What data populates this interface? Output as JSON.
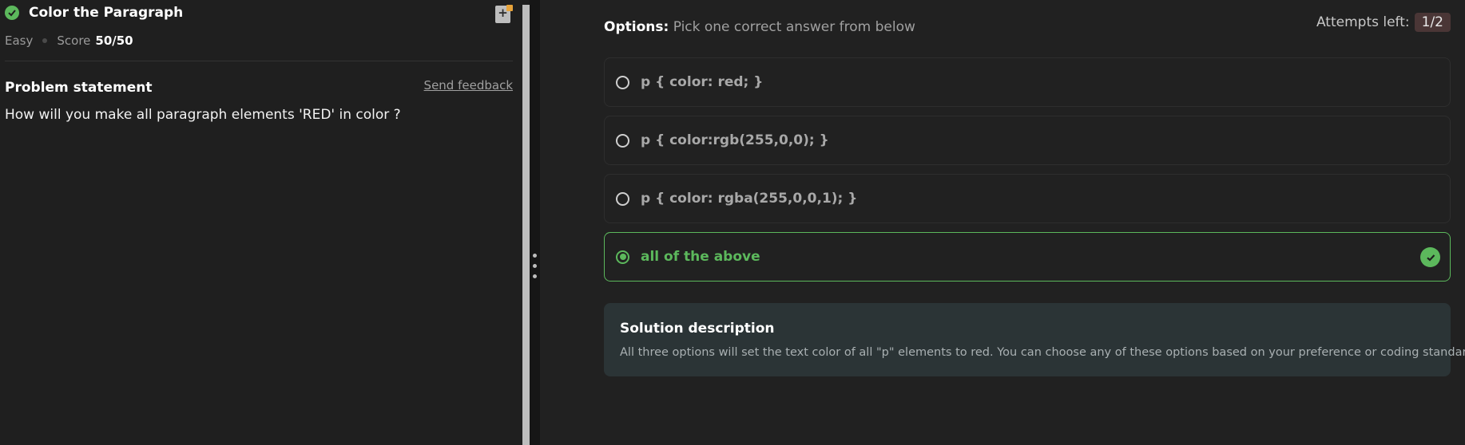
{
  "problem": {
    "title": "Color the Paragraph",
    "difficulty": "Easy",
    "score_label": "Score",
    "score_value": "50/50",
    "statement_heading": "Problem statement",
    "feedback_link": "Send feedback",
    "question": "How will you make all paragraph elements 'RED' in color ?"
  },
  "options_header": {
    "label": "Options:",
    "instruction": "Pick one correct answer from below"
  },
  "attempts": {
    "label": "Attempts left:",
    "value": "1/2"
  },
  "options": [
    {
      "text": "p { color: red; }",
      "selected": false
    },
    {
      "text": "p { color:rgb(255,0,0); }",
      "selected": false
    },
    {
      "text": "p { color: rgba(255,0,0,1); }",
      "selected": false
    },
    {
      "text": "all of the above",
      "selected": true,
      "correct": true
    }
  ],
  "solution": {
    "title": "Solution description",
    "description": "All three options will set the text color of all \"p\" elements to red. You can choose any of these options based on your preference or coding standards."
  },
  "icons": {
    "solved": "check-circle-icon",
    "bookmark": "bookmark-add-icon",
    "correct": "check-circle-icon"
  },
  "colors": {
    "success": "#5cb85c",
    "bookmark_accent": "#e7a33a",
    "attempts_badge": "#4a3636",
    "solution_bg": "#2b3436"
  }
}
